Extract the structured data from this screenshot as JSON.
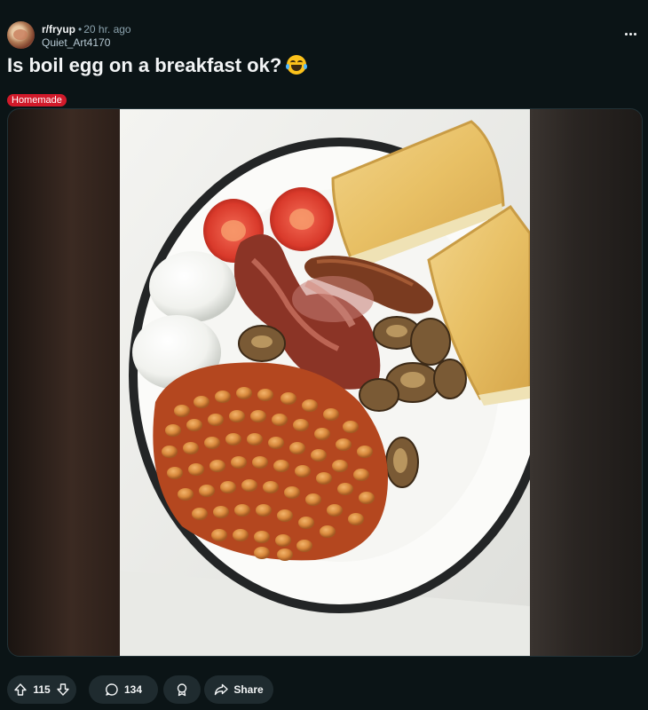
{
  "post": {
    "subreddit": "r/fryup",
    "separator": "•",
    "time": "20 hr. ago",
    "username": "Quiet_Art4170",
    "title": "Is boil egg on a breakfast ok?",
    "flair": "Homemade",
    "flair_color": "#d11a2a",
    "image_alt": "Full breakfast plate with boiled eggs, tomatoes, bacon, sausage, mushrooms, baked beans and toast"
  },
  "actions": {
    "votes": "115",
    "comments": "134",
    "share": "Share"
  },
  "icons": {
    "more": "more-horizontal-icon",
    "upvote": "upvote-arrow-icon",
    "downvote": "downvote-arrow-icon",
    "comment": "speech-bubble-icon",
    "award": "award-icon",
    "share": "share-arrow-icon"
  },
  "colors": {
    "background": "#0b1416",
    "pill": "#1f2b2f",
    "text": "#f2f4f5",
    "meta": "#8ba2ad"
  }
}
